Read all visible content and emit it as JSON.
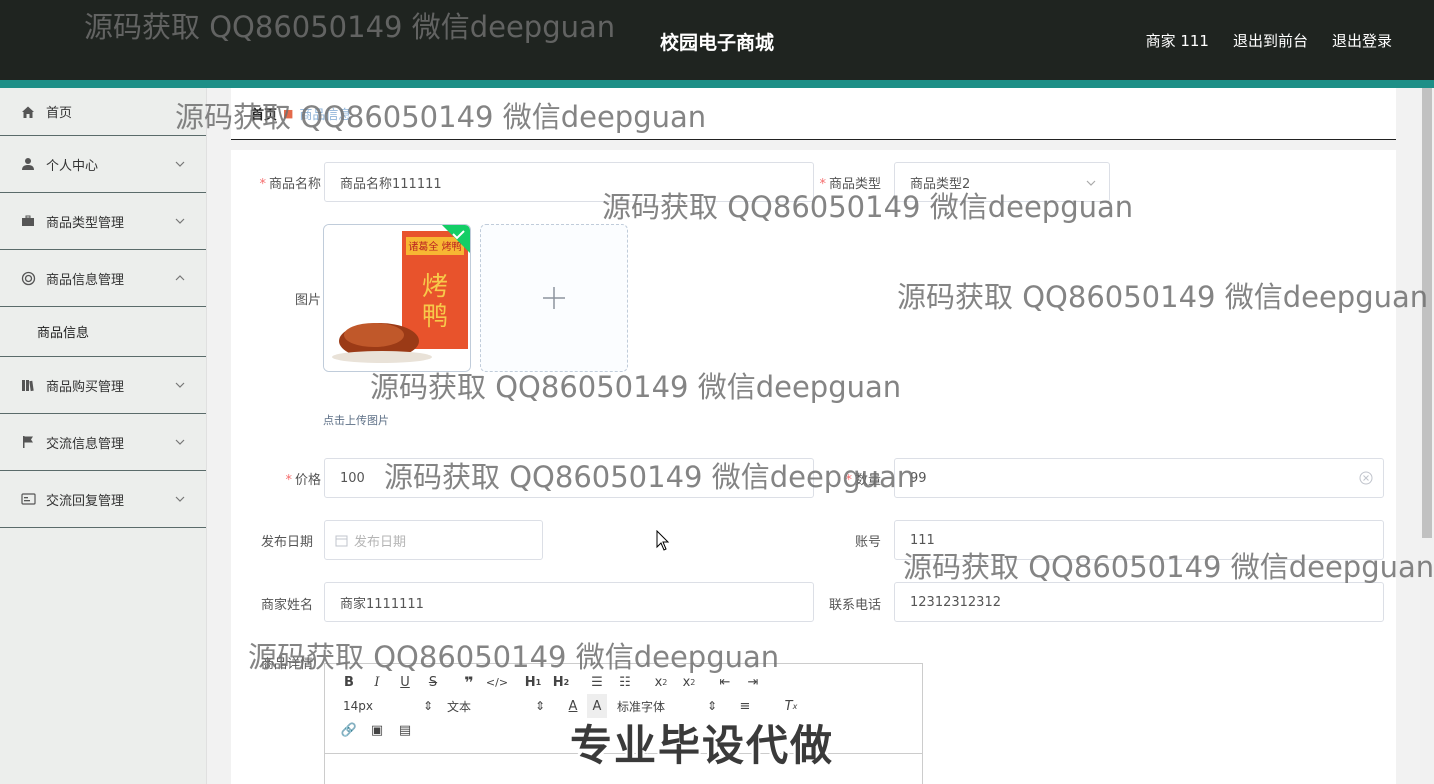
{
  "header": {
    "title": "校园电子商城",
    "nav": {
      "user": "商家 111",
      "front": "退出到前台",
      "logout": "退出登录"
    }
  },
  "sidebar": {
    "home": "首页",
    "personal": "个人中心",
    "category_mgmt": "商品类型管理",
    "goods_mgmt": "商品信息管理",
    "goods_info": "商品信息",
    "purchase_mgmt": "商品购买管理",
    "chat_mgmt": "交流信息管理",
    "reply_mgmt": "交流回复管理"
  },
  "breadcrumb": {
    "home": "首页",
    "current": "商品信息"
  },
  "form": {
    "name": {
      "label": "商品名称",
      "value": "商品名称111111"
    },
    "type": {
      "label": "商品类型",
      "value": "商品类型2"
    },
    "image": {
      "label": "图片",
      "tip": "点击上传图片",
      "thumb_text": "诸葛全 烤鸭"
    },
    "price": {
      "label": "价格",
      "value": "100"
    },
    "quantity": {
      "label": "数量",
      "value": "99"
    },
    "publish_date": {
      "label": "发布日期",
      "placeholder": "发布日期"
    },
    "account": {
      "label": "账号",
      "value": "111"
    },
    "merchant_name": {
      "label": "商家姓名",
      "value": "商家1111111"
    },
    "phone": {
      "label": "联系电话",
      "value": "12312312312"
    },
    "detail": {
      "label": "商品详情"
    }
  },
  "editor": {
    "font_size": "14px",
    "block_type": "文本",
    "font_family": "标准字体"
  },
  "watermark_text": "源码获取 QQ86050149 微信deepguan",
  "stamp_text": "专业毕设代做",
  "colors": {
    "header_bg": "#1f2420",
    "accent": "#1e8f87",
    "required": "#f56c6c"
  }
}
